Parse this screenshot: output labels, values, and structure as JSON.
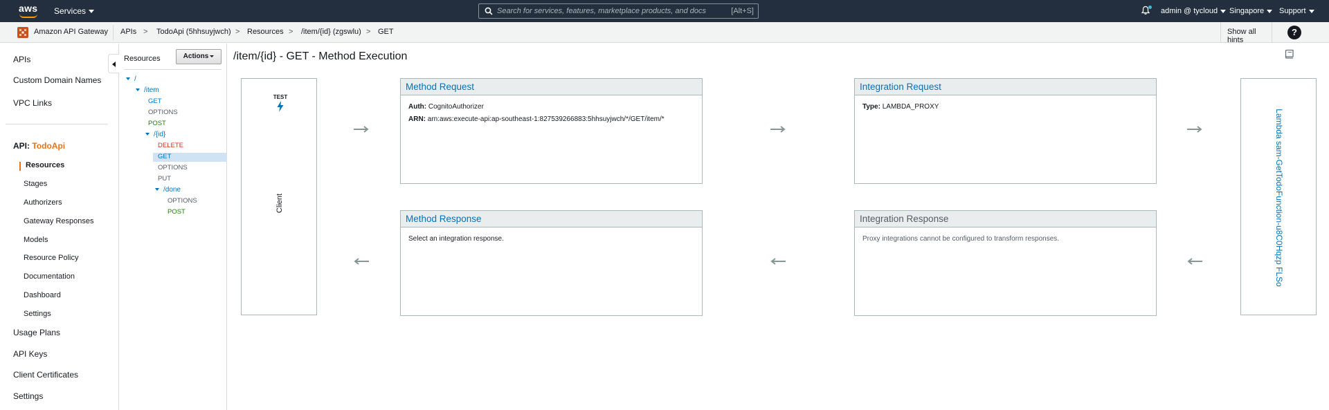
{
  "topnav": {
    "logo_text": "aws",
    "services_label": "Services",
    "search_placeholder": "Search for services, features, marketplace products, and docs",
    "search_shortcut": "[Alt+S]",
    "account_label": "admin @ tycloud",
    "region_label": "Singapore",
    "support_label": "Support"
  },
  "breadcrumb": {
    "service_name": "Amazon API Gateway",
    "items": [
      "APIs",
      "TodoApi (5hhsuyjwch)",
      "Resources",
      "/item/{id} (zgswlu)",
      "GET"
    ],
    "separator": ">",
    "hints_label": "Show all hints",
    "help_label": "?"
  },
  "leftnav": {
    "top_items": [
      "APIs",
      "Custom Domain Names",
      "VPC Links"
    ],
    "api_prefix": "API:",
    "api_name": "TodoApi",
    "api_items": [
      "Resources",
      "Stages",
      "Authorizers",
      "Gateway Responses",
      "Models",
      "Resource Policy",
      "Documentation",
      "Dashboard",
      "Settings"
    ],
    "bottom_items": [
      "Usage Plans",
      "API Keys",
      "Client Certificates",
      "Settings"
    ]
  },
  "resources": {
    "title": "Resources",
    "actions_label": "Actions",
    "tree": [
      {
        "label": "/",
        "kind": "path"
      },
      {
        "label": "/item",
        "kind": "path"
      },
      {
        "label": "GET",
        "kind": "get"
      },
      {
        "label": "OPTIONS",
        "kind": "options"
      },
      {
        "label": "POST",
        "kind": "post"
      },
      {
        "label": "/{id}",
        "kind": "path"
      },
      {
        "label": "DELETE",
        "kind": "delete"
      },
      {
        "label": "GET",
        "kind": "get",
        "selected": true
      },
      {
        "label": "OPTIONS",
        "kind": "options"
      },
      {
        "label": "PUT",
        "kind": "put"
      },
      {
        "label": "/done",
        "kind": "path"
      },
      {
        "label": "OPTIONS",
        "kind": "options"
      },
      {
        "label": "POST",
        "kind": "post"
      }
    ]
  },
  "main": {
    "title": "/item/{id} - GET - Method Execution",
    "client": {
      "test_label": "TEST",
      "label": "Client"
    },
    "method_request": {
      "title": "Method Request",
      "auth_key": "Auth:",
      "auth_value": "CognitoAuthorizer",
      "arn_key": "ARN:",
      "arn_value": "arn:aws:execute-api:ap-southeast-1:827539266883:5hhsuyjwch/*/GET/item/*"
    },
    "integration_request": {
      "title": "Integration Request",
      "type_key": "Type:",
      "type_value": "LAMBDA_PROXY"
    },
    "method_response": {
      "title": "Method Response",
      "body": "Select an integration response."
    },
    "integration_response": {
      "title": "Integration Response",
      "body": "Proxy integrations cannot be configured to transform responses."
    },
    "lambda_label": "Lambda sam-GetTodoFunction-u8C0Hqzp FLSo"
  },
  "colors": {
    "topnav_bg": "#232f3e",
    "link_blue": "#0073bb",
    "accent_orange": "#ec7211",
    "post_green": "#1d8102",
    "delete_red": "#d13212"
  }
}
